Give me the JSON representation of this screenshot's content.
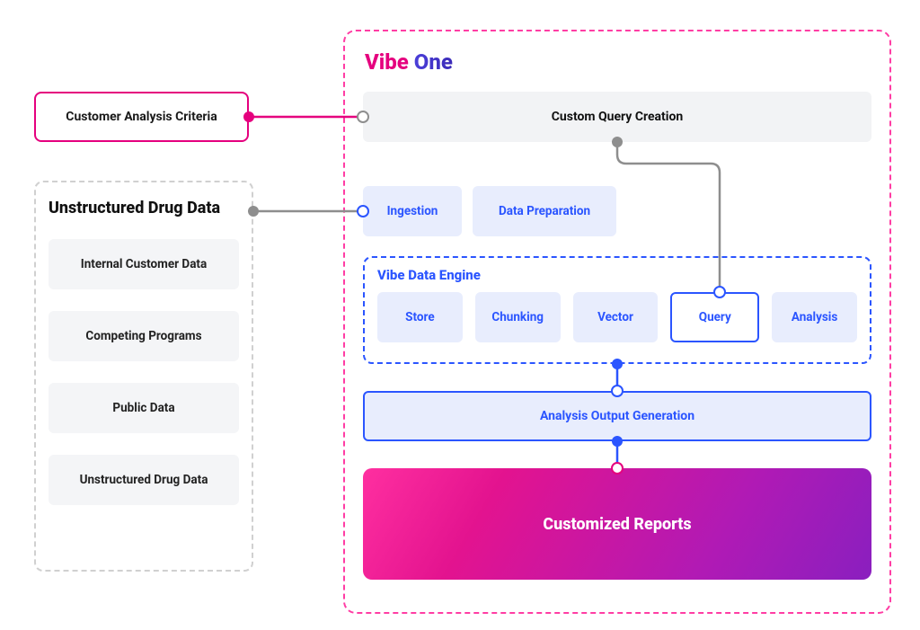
{
  "left": {
    "criteria_label": "Customer Analysis Criteria",
    "drugdata_title": "Unstructured Drug Data",
    "drugdata_items": [
      "Internal Customer Data",
      "Competing Programs",
      "Public Data",
      "Unstructured Drug Data"
    ]
  },
  "vibe": {
    "title_part1": "Vibe",
    "title_part2": "One",
    "custom_query_label": "Custom Query Creation",
    "ingestion_label": "Ingestion",
    "dataprep_label": "Data Preparation",
    "engine_title": "Vibe Data Engine",
    "engine_cells": [
      "Store",
      "Chunking",
      "Vector",
      "Query",
      "Analysis"
    ],
    "engine_active_index": 3,
    "analysis_output_label": "Analysis Output Generation",
    "reports_label": "Customized Reports"
  },
  "colors": {
    "pink": "#e5007e",
    "blue": "#2b55ff",
    "gray_stroke": "#8e8e8e",
    "light_blue_fill": "#e8edfd"
  }
}
